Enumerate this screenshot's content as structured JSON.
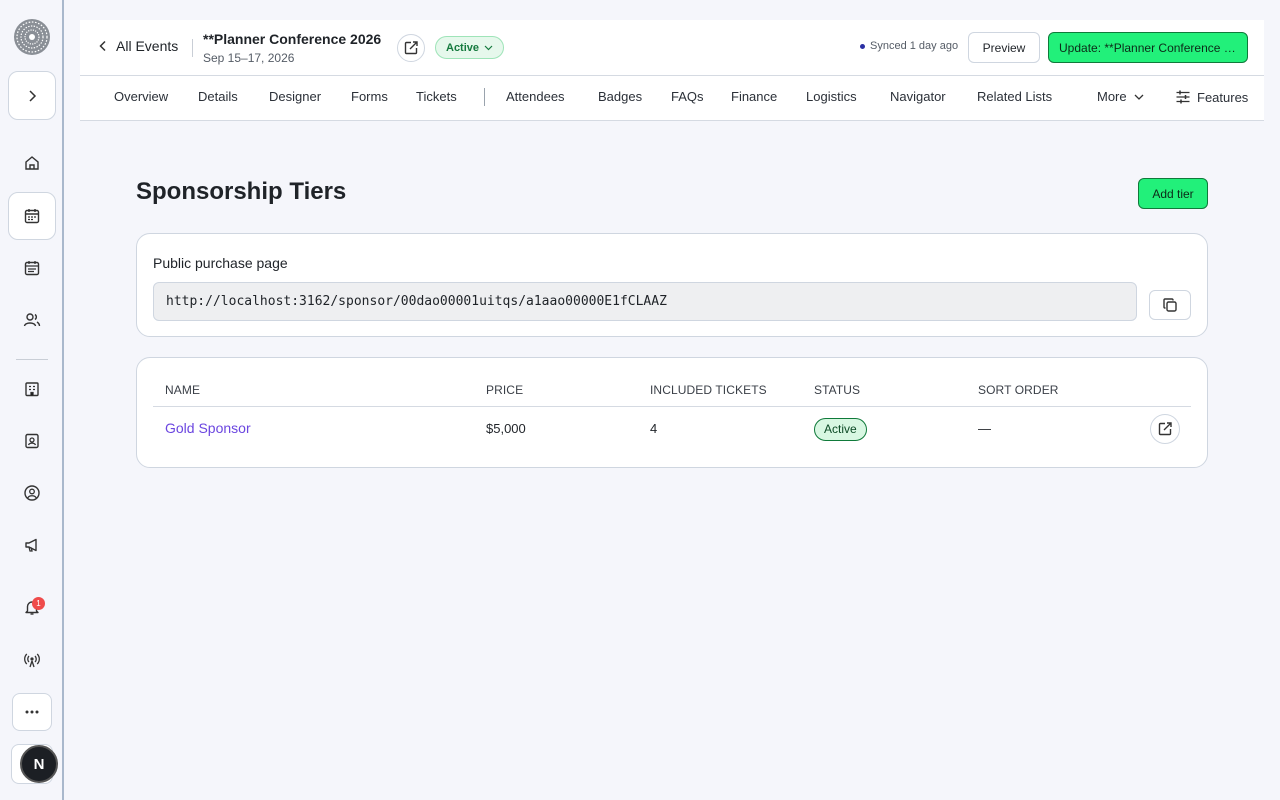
{
  "header": {
    "back_label": "All Events",
    "event_title": "**Planner Conference 2026",
    "event_dates": "Sep 15–17, 2026",
    "status": "Active",
    "synced": "Synced 1 day ago",
    "preview_label": "Preview",
    "update_label": "Update: **Planner Conference 2026"
  },
  "tabs": [
    {
      "label": "Overview"
    },
    {
      "label": "Details"
    },
    {
      "label": "Designer"
    },
    {
      "label": "Forms"
    },
    {
      "label": "Tickets"
    },
    {
      "label": "Attendees"
    },
    {
      "label": "Badges"
    },
    {
      "label": "FAQs"
    },
    {
      "label": "Finance"
    },
    {
      "label": "Logistics"
    },
    {
      "label": "Navigator"
    },
    {
      "label": "Related Lists"
    }
  ],
  "more_label": "More",
  "features_label": "Features",
  "page": {
    "title": "Sponsorship Tiers",
    "add_label": "Add tier"
  },
  "purchase": {
    "label": "Public purchase page",
    "url": "http://localhost:3162/sponsor/00dao00001uitqs/a1aao00000E1fCLAAZ"
  },
  "table": {
    "columns": [
      "NAME",
      "PRICE",
      "INCLUDED TICKETS",
      "STATUS",
      "SORT ORDER"
    ],
    "rows": [
      {
        "name": "Gold Sponsor",
        "price": "$5,000",
        "tickets": "4",
        "status": "Active",
        "sort": "—"
      }
    ]
  },
  "rail": {
    "notification_count": "1",
    "avatar_initial": "N"
  },
  "colors": {
    "accent_green": "#22f07a",
    "link_purple": "#6b46e0",
    "badge_red": "#ef4b4b"
  }
}
